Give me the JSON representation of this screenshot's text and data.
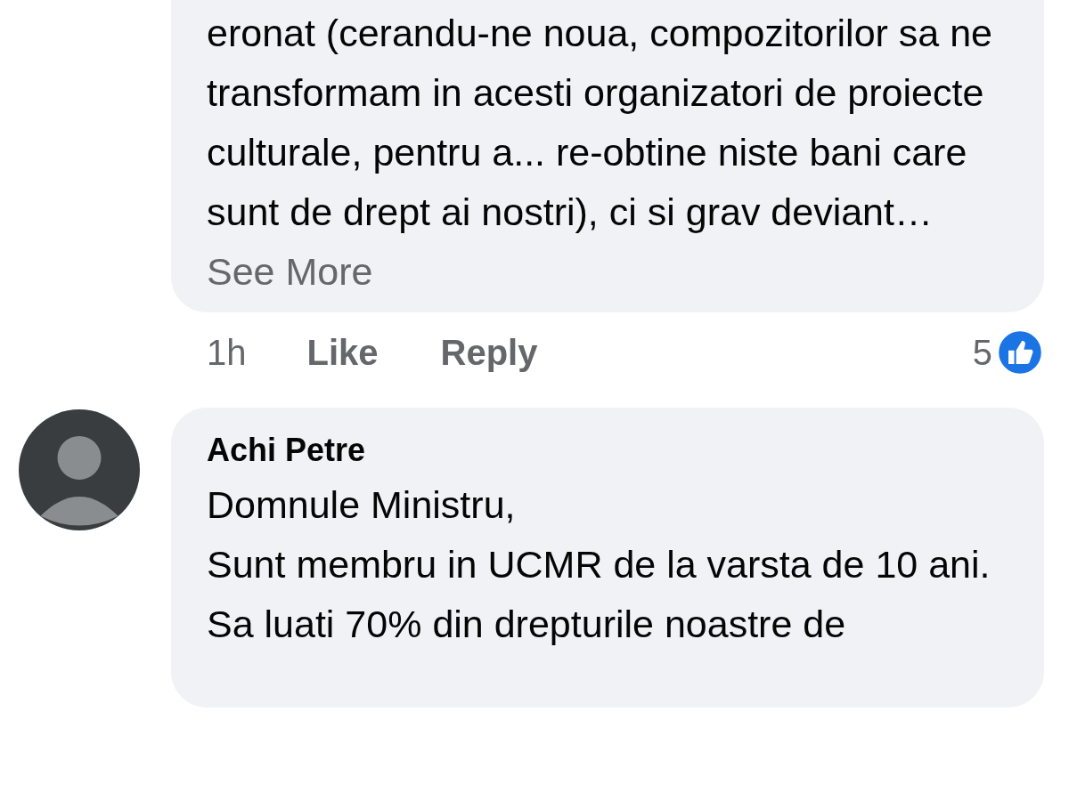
{
  "comments": [
    {
      "text": "eronat (cerandu-ne noua, compozitorilor sa ne transformam in acesti organizatori de proiecte culturale, pentru a... re-obtine niste bani care sunt de drept ai nostri), ci si grav deviant…",
      "see_more": "See More",
      "time": "1h",
      "actions": [
        "Like",
        "Reply"
      ],
      "reaction_count": "5"
    },
    {
      "author": "Achi Petre",
      "text": "Domnule Ministru,\nSunt membru in UCMR de la varsta de 10 ani.\nSa luati 70% din drepturile noastre de"
    }
  ]
}
